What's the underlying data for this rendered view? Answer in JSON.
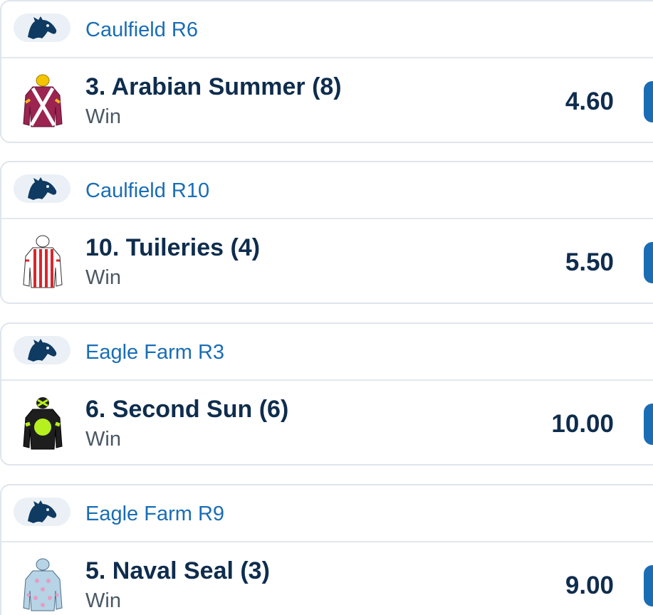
{
  "colors": {
    "accent": "#1a6db5",
    "text_dark": "#0f2d4d",
    "border": "#dfe5ec"
  },
  "selections": [
    {
      "race_icon": "horse-head-icon",
      "race": "Caulfield R6",
      "runner": "3. Arabian Summer (8)",
      "bet_type": "Win",
      "odds": "4.60",
      "silk": "maroon-white-cross-silk-icon"
    },
    {
      "race_icon": "horse-head-icon",
      "race": "Caulfield R10",
      "runner": "10. Tuileries (4)",
      "bet_type": "Win",
      "odds": "5.50",
      "silk": "red-white-stripes-silk-icon"
    },
    {
      "race_icon": "horse-head-icon",
      "race": "Eagle Farm R3",
      "runner": "6. Second Sun (6)",
      "bet_type": "Win",
      "odds": "10.00",
      "silk": "black-lime-spot-silk-icon"
    },
    {
      "race_icon": "horse-head-icon",
      "race": "Eagle Farm R9",
      "runner": "5. Naval Seal (3)",
      "bet_type": "Win",
      "odds": "9.00",
      "silk": "pale-blue-pink-spots-silk-icon"
    }
  ]
}
